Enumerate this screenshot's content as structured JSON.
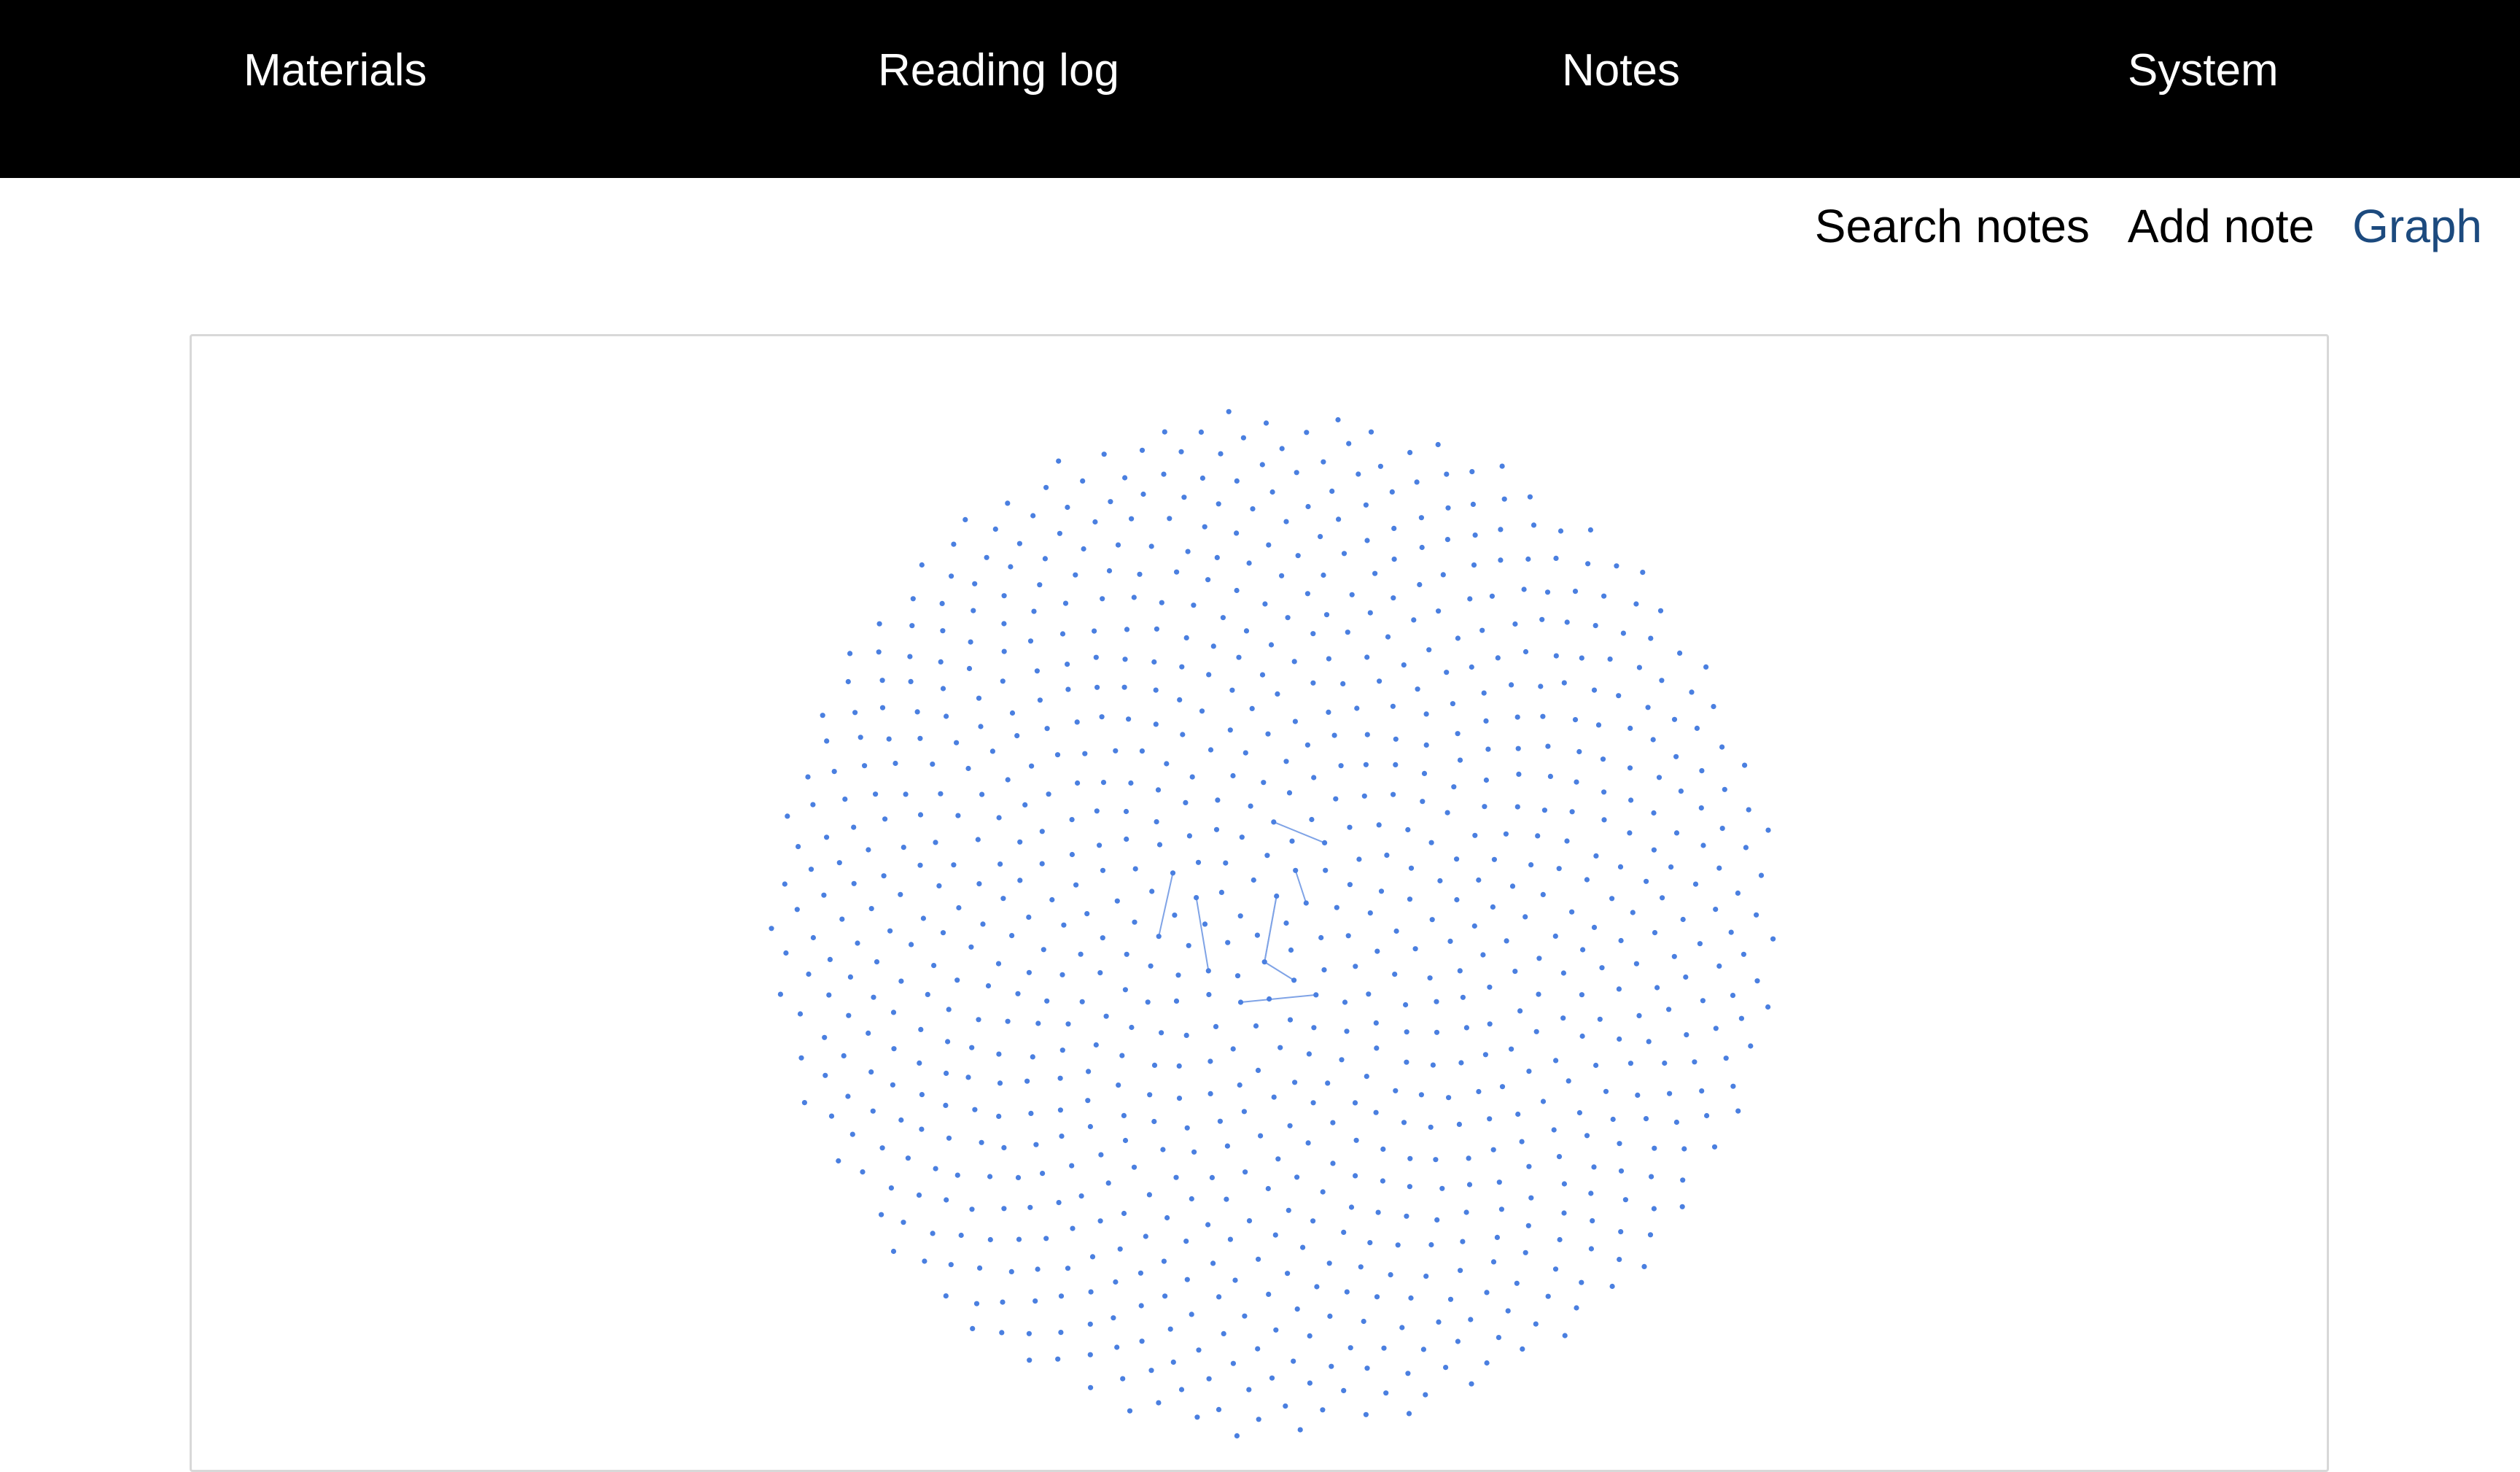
{
  "nav": {
    "items": [
      {
        "label": "Materials"
      },
      {
        "label": "Reading log"
      },
      {
        "label": "Notes"
      },
      {
        "label": "System"
      }
    ]
  },
  "subnav": {
    "items": [
      {
        "label": "Search notes",
        "active": false
      },
      {
        "label": "Add note",
        "active": false
      },
      {
        "label": "Graph",
        "active": true
      }
    ]
  },
  "graph": {
    "node_color": "#4a7fe0",
    "edge_color": "#7fa3e6"
  },
  "colors": {
    "nav_bg": "#000000",
    "nav_text": "#ffffff",
    "active_link": "#1c4a7e",
    "panel_border": "#d8d8d8"
  }
}
